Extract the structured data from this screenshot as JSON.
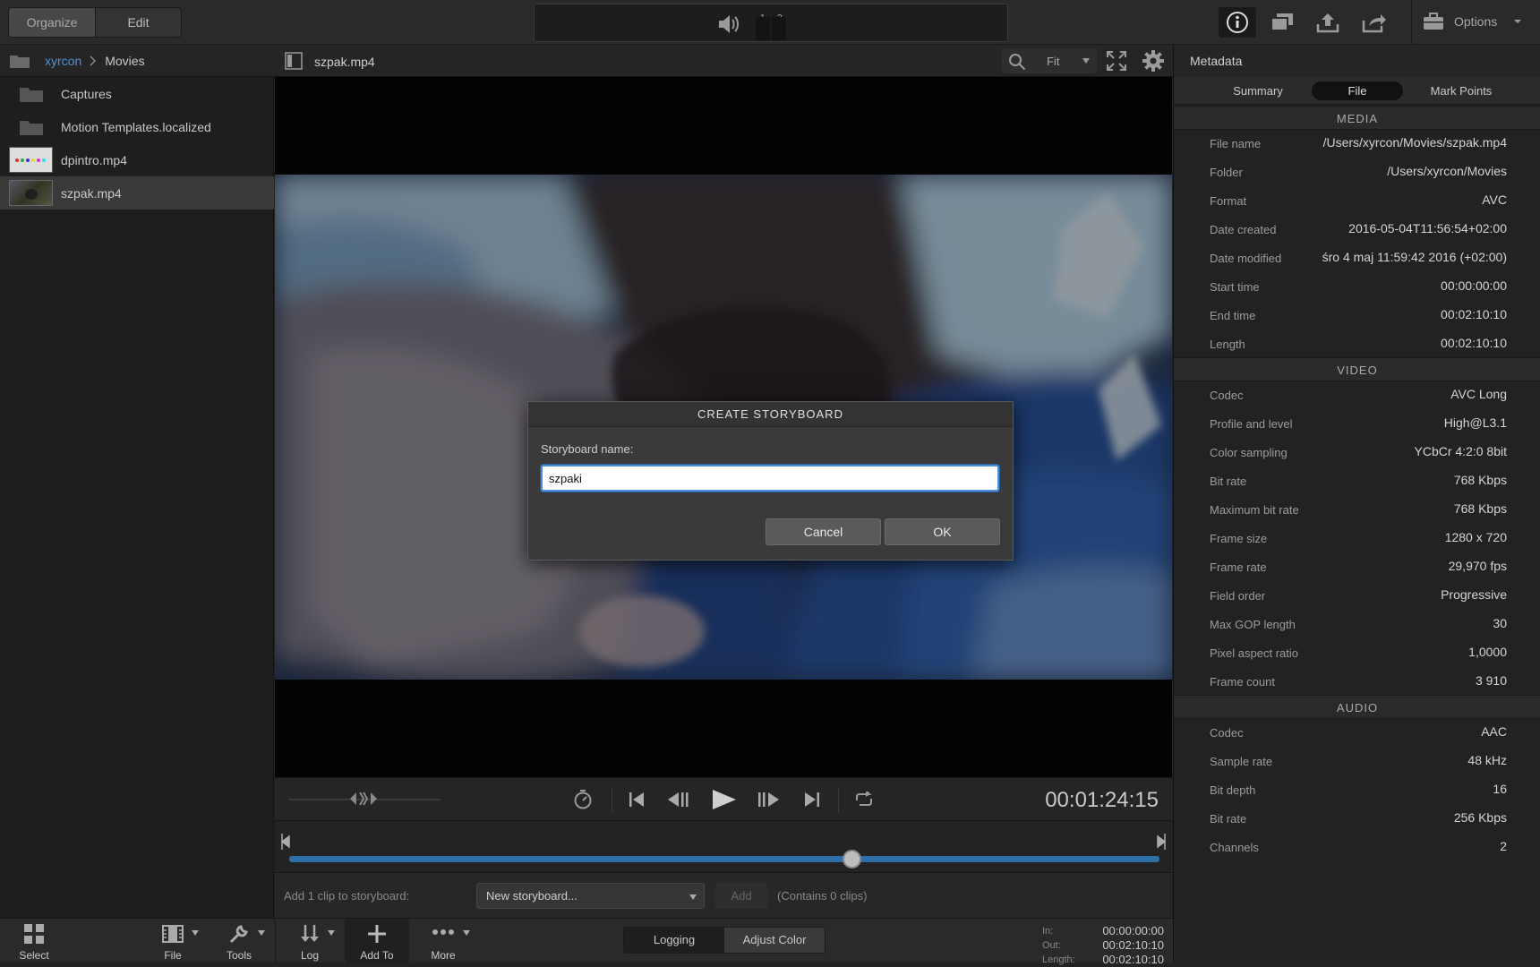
{
  "topbar": {
    "organize_label": "Organize",
    "edit_label": "Edit",
    "meter1": "1",
    "meter2": "2",
    "options_label": "Options"
  },
  "browser": {
    "breadcrumb_root": "xyrcon",
    "breadcrumb_current": "Movies",
    "items": [
      {
        "label": "Captures",
        "icon": "folder-icon"
      },
      {
        "label": "Motion Templates.localized",
        "icon": "folder-icon"
      },
      {
        "label": "dpintro.mp4",
        "icon": "video-thumbnail"
      },
      {
        "label": "szpak.mp4",
        "icon": "video-thumbnail",
        "selected": true
      }
    ]
  },
  "viewer": {
    "filename": "szpak.mp4",
    "zoom_label": "Fit",
    "timecode": "00:01:24:15"
  },
  "storyboard_bar": {
    "add_label": "Add 1 clip to storyboard:",
    "dropdown_value": "New storyboard...",
    "add_button": "Add",
    "contains": "(Contains 0 clips)"
  },
  "bottom": {
    "select": "Select",
    "file": "File",
    "tools": "Tools",
    "log": "Log",
    "add_to": "Add To",
    "more": "More",
    "logging": "Logging",
    "adjust_color": "Adjust Color",
    "in_label": "In:",
    "in_value": "00:00:00:00",
    "out_label": "Out:",
    "out_value": "00:02:10:10",
    "length_label": "Length:",
    "length_value": "00:02:10:10"
  },
  "metadata": {
    "title": "Metadata",
    "tabs": [
      "Summary",
      "File",
      "Mark Points"
    ],
    "active_tab": "File",
    "media_header": "MEDIA",
    "media": [
      {
        "k": "File name",
        "v": "/Users/xyrcon/Movies/szpak.mp4"
      },
      {
        "k": "Folder",
        "v": "/Users/xyrcon/Movies"
      },
      {
        "k": "Format",
        "v": "AVC"
      },
      {
        "k": "Date created",
        "v": "2016-05-04T11:56:54+02:00"
      },
      {
        "k": "Date modified",
        "v": "śro  4 maj 11:59:42 2016 (+02:00)"
      },
      {
        "k": "Start time",
        "v": "00:00:00:00"
      },
      {
        "k": "End time",
        "v": "00:02:10:10"
      },
      {
        "k": "Length",
        "v": "00:02:10:10"
      }
    ],
    "video_header": "VIDEO",
    "video": [
      {
        "k": "Codec",
        "v": "AVC Long"
      },
      {
        "k": "Profile and level",
        "v": "High@L3.1"
      },
      {
        "k": "Color sampling",
        "v": "YCbCr 4:2:0 8bit"
      },
      {
        "k": "Bit rate",
        "v": "768 Kbps"
      },
      {
        "k": "Maximum bit rate",
        "v": "768 Kbps"
      },
      {
        "k": "Frame size",
        "v": "1280 x 720"
      },
      {
        "k": "Frame rate",
        "v": "29,970 fps"
      },
      {
        "k": "Field order",
        "v": "Progressive"
      },
      {
        "k": "Max GOP length",
        "v": "30"
      },
      {
        "k": "Pixel aspect ratio",
        "v": "1,0000"
      },
      {
        "k": "Frame count",
        "v": "3 910"
      }
    ],
    "audio_header": "AUDIO",
    "audio": [
      {
        "k": "Codec",
        "v": "AAC"
      },
      {
        "k": "Sample rate",
        "v": "48 kHz"
      },
      {
        "k": "Bit depth",
        "v": "16"
      },
      {
        "k": "Bit rate",
        "v": "256 Kbps"
      },
      {
        "k": "Channels",
        "v": "2"
      }
    ]
  },
  "dialog": {
    "title": "CREATE STORYBOARD",
    "label": "Storyboard name:",
    "value": "szpaki",
    "cancel": "Cancel",
    "ok": "OK"
  },
  "colors": {
    "accent": "#4a8fd8",
    "scrub_bar": "#2f6fa8",
    "breadcrumb_link": "#4f92d3"
  }
}
